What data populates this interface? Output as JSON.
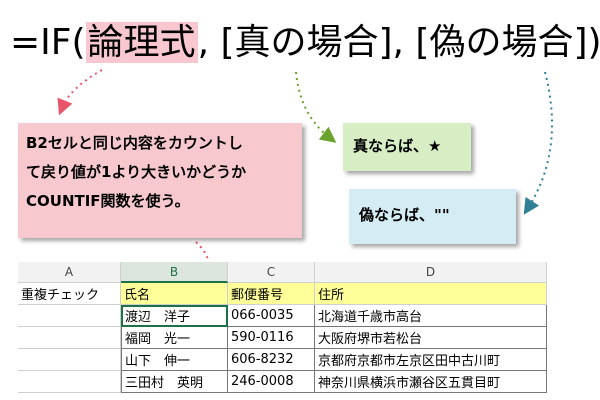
{
  "formula": {
    "prefix": "=IF(",
    "highlight": "論理式",
    "rest": ", [真の場合], [偽の場合])"
  },
  "callouts": {
    "pink": [
      "B2セルと同じ内容をカウントし",
      "て戻り値が1より大きいかどうか",
      "COUNTIF関数を使う。"
    ],
    "green": "真ならば、★",
    "blue": "偽ならば、\"\""
  },
  "sheet": {
    "columns": [
      "A",
      "B",
      "C",
      "D"
    ],
    "header_row": [
      "重複チェック",
      "氏名",
      "郵便番号",
      "住所"
    ],
    "rows": [
      [
        "",
        "渡辺　洋子",
        "066-0035",
        "北海道千歳市高台"
      ],
      [
        "",
        "福岡　光一",
        "590-0116",
        "大阪府堺市若松台"
      ],
      [
        "",
        "山下　伸一",
        "606-8232",
        "京都府京都市左京区田中古川町"
      ],
      [
        "",
        "三田村　英明",
        "246-0008",
        "神奈川県横浜市瀬谷区五貫目町"
      ]
    ]
  },
  "colors": {
    "highlight_pink": "#f9c7cf",
    "arrow_pink": "#e8546a",
    "arrow_green": "#6aa22e",
    "arrow_blue": "#2e7f95",
    "cell_yellow": "#ffff99"
  }
}
